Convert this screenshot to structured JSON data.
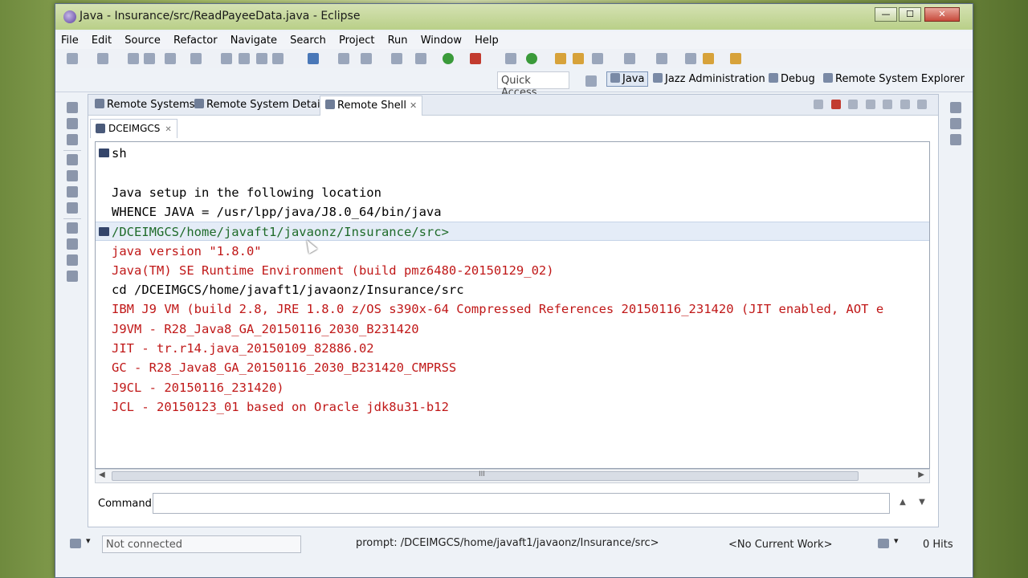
{
  "window": {
    "title": "Java - Insurance/src/ReadPayeeData.java - Eclipse",
    "controls": {
      "minimize": "—",
      "maximize": "☐",
      "close": "✕"
    }
  },
  "menu": {
    "items": [
      "File",
      "Edit",
      "Source",
      "Refactor",
      "Navigate",
      "Search",
      "Project",
      "Run",
      "Window",
      "Help"
    ]
  },
  "perspectives": {
    "quick_access": "Quick Access",
    "items": [
      {
        "label": "Java",
        "active": true
      },
      {
        "label": "Jazz Administration",
        "active": false
      },
      {
        "label": "Debug",
        "active": false
      },
      {
        "label": "Remote System Explorer",
        "active": false
      }
    ]
  },
  "view": {
    "tabs": [
      {
        "label": "Remote Systems",
        "active": false
      },
      {
        "label": "Remote System Details",
        "active": false
      },
      {
        "label": "Remote Shell",
        "active": true,
        "close": "✕"
      }
    ],
    "shell_tab": {
      "label": "DCEIMGCS",
      "close": "✕"
    }
  },
  "console": {
    "lines": [
      {
        "text": "sh",
        "color": "black",
        "icon": true
      },
      {
        "text": "",
        "color": "black",
        "icon": false
      },
      {
        "text": "Java setup in the following location",
        "color": "black",
        "icon": false
      },
      {
        "text": "WHENCE JAVA = /usr/lpp/java/J8.0_64/bin/java",
        "color": "black",
        "icon": false
      },
      {
        "text": "/DCEIMGCS/home/javaft1/javaonz/Insurance/src>",
        "color": "green",
        "icon": true
      },
      {
        "text": "java version \"1.8.0\"",
        "color": "red",
        "icon": false
      },
      {
        "text": "Java(TM) SE Runtime Environment (build pmz6480-20150129_02)",
        "color": "red",
        "icon": false
      },
      {
        "text": "cd /DCEIMGCS/home/javaft1/javaonz/Insurance/src",
        "color": "black",
        "icon": false
      },
      {
        "text": "IBM J9 VM (build 2.8, JRE 1.8.0 z/OS s390x-64 Compressed References 20150116_231420 (JIT enabled, AOT e",
        "color": "red",
        "icon": false
      },
      {
        "text": "J9VM - R28_Java8_GA_20150116_2030_B231420",
        "color": "red",
        "icon": false
      },
      {
        "text": "JIT  - tr.r14.java_20150109_82886.02",
        "color": "red",
        "icon": false
      },
      {
        "text": "GC   - R28_Java8_GA_20150116_2030_B231420_CMPRSS",
        "color": "red",
        "icon": false
      },
      {
        "text": "J9CL - 20150116_231420)",
        "color": "red",
        "icon": false
      },
      {
        "text": "JCL - 20150123_01 based on Oracle jdk8u31-b12",
        "color": "red",
        "icon": false
      }
    ],
    "scroll_left": "◀",
    "scroll_right": "▶",
    "scroll_grip": "III"
  },
  "command": {
    "label": "Command",
    "value": "",
    "nav_up": "▲",
    "nav_down": "▼"
  },
  "status": {
    "connection": "Not connected",
    "prompt": "prompt: /DCEIMGCS/home/javaft1/javaonz/Insurance/src>",
    "work": "<No Current Work>",
    "hits": "0 Hits",
    "dropdown": "▾"
  },
  "colors": {
    "console_red": "#c01818",
    "console_green": "#1f6b2a",
    "prompt_highlight": "#e4ecf7"
  }
}
